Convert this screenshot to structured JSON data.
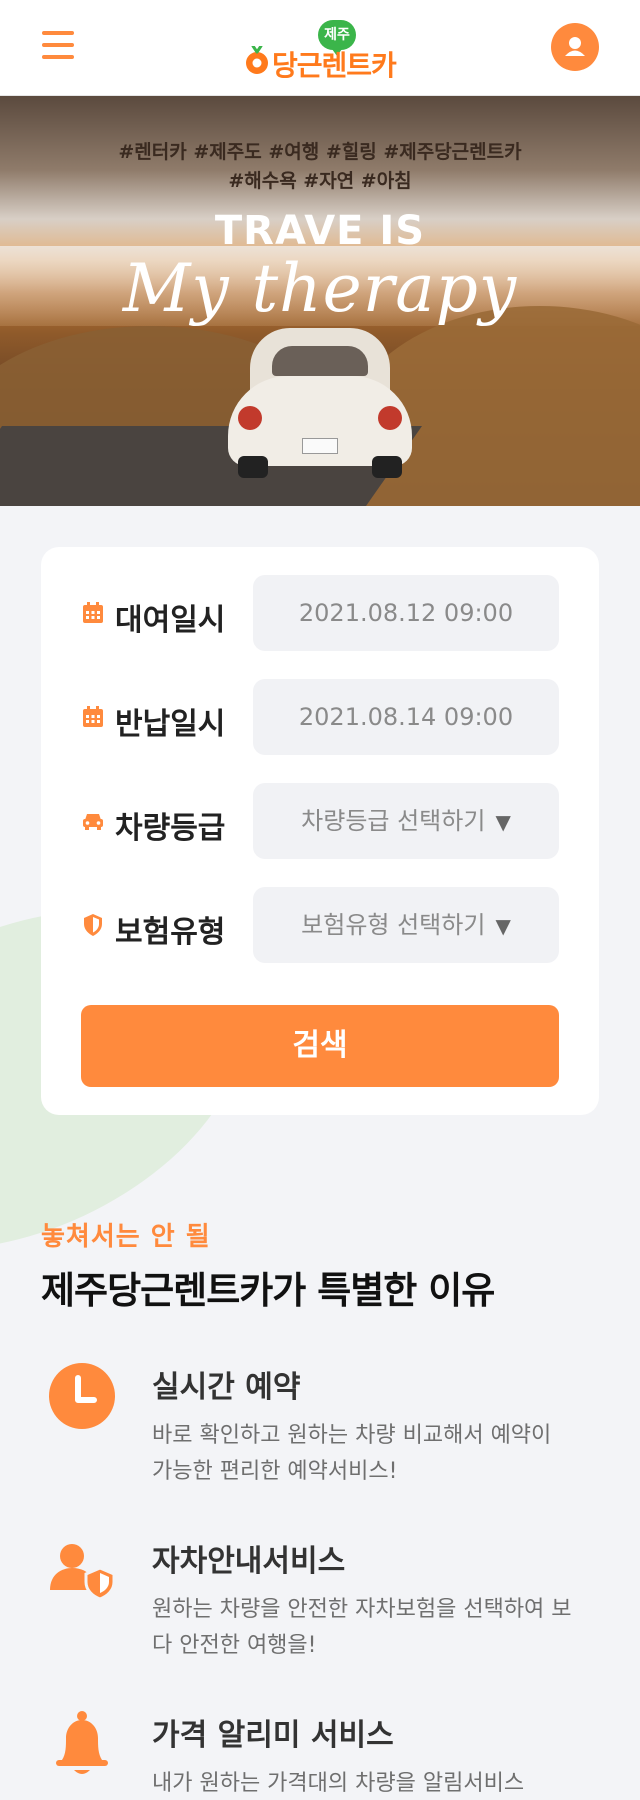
{
  "header": {
    "menu_icon": "hamburger-icon",
    "logo_badge": "제주",
    "logo_text": "당근렌트카",
    "user_icon": "user-icon"
  },
  "hero": {
    "tags_line1": "#렌터카 #제주도 #여행 #힐링 #제주당근렌트카",
    "tags_line2": "#해수욕 #자연 #아침",
    "title": "TRAVE IS",
    "script": "My therapy"
  },
  "search": {
    "rental_label": "대여일시",
    "rental_value": "2021.08.12   09:00",
    "return_label": "반납일시",
    "return_value": "2021.08.14   09:00",
    "class_label": "차량등급",
    "class_placeholder": "차량등급 선택하기",
    "insurance_label": "보험유형",
    "insurance_placeholder": "보험유형 선택하기",
    "search_button": "검색",
    "colors": {
      "accent": "#ff8a3d",
      "field_bg": "#f1f2f5"
    }
  },
  "why": {
    "subtitle": "놓쳐서는 안 될",
    "title": "제주당근렌트카가 특별한 이유",
    "features": [
      {
        "icon": "clock-icon",
        "title": "실시간 예약",
        "desc": "바로 확인하고 원하는 차량 비교해서 예약이 가능한 편리한 예약서비스!"
      },
      {
        "icon": "user-shield-icon",
        "title": "자차안내서비스",
        "desc": "원하는 차량을 안전한 자차보험을 선택하여 보다 안전한 여행을!"
      },
      {
        "icon": "bell-icon",
        "title": "가격 알리미 서비스",
        "desc": "내가 원하는 가격대의 차량을 알림서비스"
      }
    ]
  }
}
